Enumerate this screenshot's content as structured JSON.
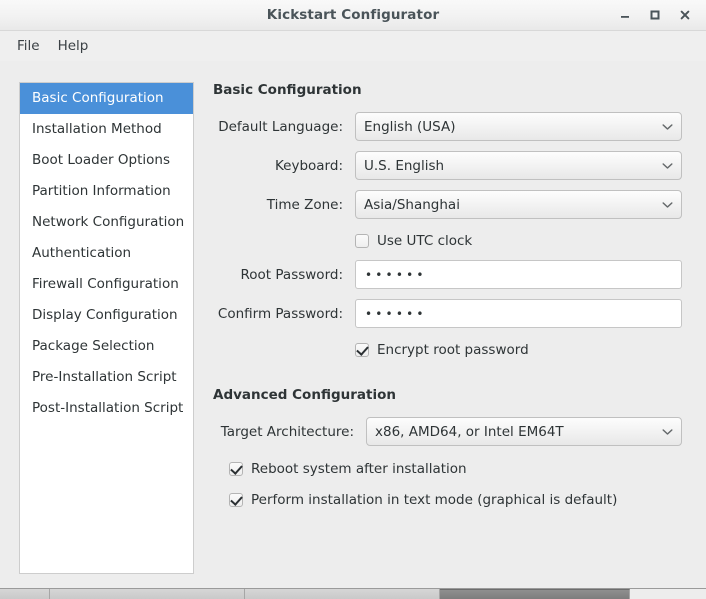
{
  "window": {
    "title": "Kickstart Configurator",
    "controls": [
      {
        "name": "minimize",
        "glyph": "minimize-icon"
      },
      {
        "name": "maximize",
        "glyph": "maximize-icon"
      },
      {
        "name": "close",
        "glyph": "close-icon"
      }
    ]
  },
  "menubar": {
    "items": [
      {
        "label": "File"
      },
      {
        "label": "Help"
      }
    ]
  },
  "sidebar": {
    "items": [
      {
        "label": "Basic Configuration",
        "selected": true
      },
      {
        "label": "Installation Method",
        "selected": false
      },
      {
        "label": "Boot Loader Options",
        "selected": false
      },
      {
        "label": "Partition Information",
        "selected": false
      },
      {
        "label": "Network Configuration",
        "selected": false
      },
      {
        "label": "Authentication",
        "selected": false
      },
      {
        "label": "Firewall Configuration",
        "selected": false
      },
      {
        "label": "Display Configuration",
        "selected": false
      },
      {
        "label": "Package Selection",
        "selected": false
      },
      {
        "label": "Pre-Installation Script",
        "selected": false
      },
      {
        "label": "Post-Installation Script",
        "selected": false
      }
    ]
  },
  "basic": {
    "section_title": "Basic Configuration",
    "default_language_label": "Default Language:",
    "default_language_value": "English (USA)",
    "keyboard_label": "Keyboard:",
    "keyboard_value": "U.S. English",
    "timezone_label": "Time Zone:",
    "timezone_value": "Asia/Shanghai",
    "use_utc_label": "Use UTC clock",
    "use_utc_checked": false,
    "root_password_label": "Root Password:",
    "root_password_value": "••••••",
    "confirm_password_label": "Confirm Password:",
    "confirm_password_value": "••••••",
    "encrypt_label": "Encrypt root password",
    "encrypt_checked": true
  },
  "advanced": {
    "section_title": "Advanced Configuration",
    "target_arch_label": "Target Architecture:",
    "target_arch_value": "x86, AMD64, or Intel EM64T",
    "reboot_label": "Reboot system after installation",
    "reboot_checked": true,
    "textmode_label": "Perform installation in text mode (graphical is default)",
    "textmode_checked": true
  },
  "colors": {
    "selection_blue": "#4a90d9",
    "window_background": "#ededed",
    "panel_white": "#ffffff",
    "text": "#2e3436",
    "titlebar_text": "#4a5459"
  }
}
